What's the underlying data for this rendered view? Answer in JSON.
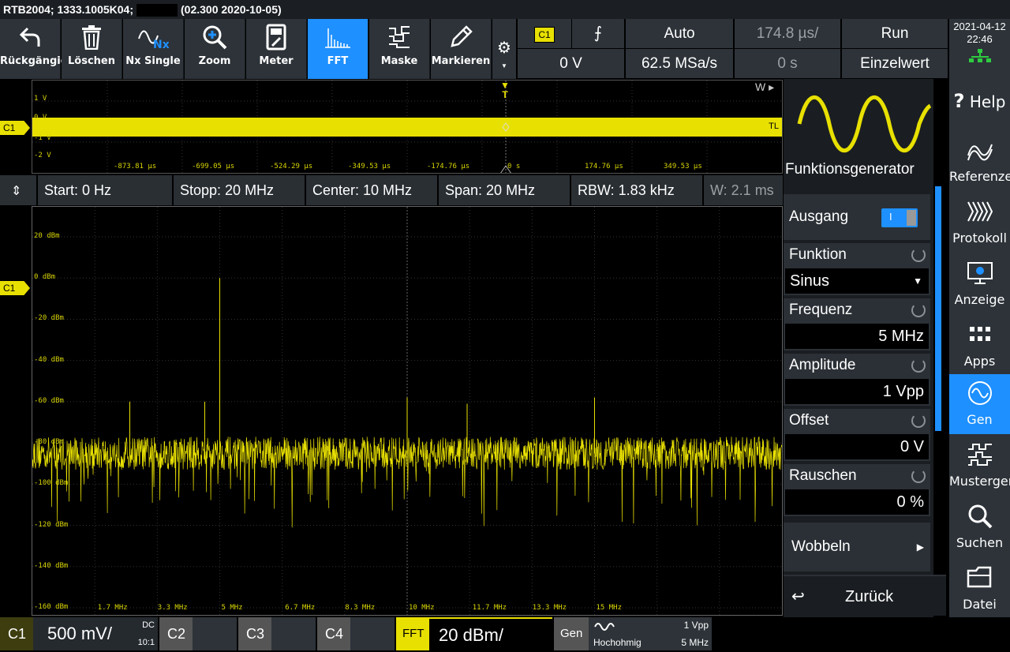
{
  "title_bar": {
    "text_a": "RTB2004; 1333.1005K04;",
    "text_b": "(02.300 2020-10-05)"
  },
  "toolbar": [
    {
      "label": "Rückgängig",
      "icon": "undo-icon"
    },
    {
      "label": "Löschen",
      "icon": "trash-icon"
    },
    {
      "label": "Nx Single",
      "icon": "nx-single-icon"
    },
    {
      "label": "Zoom",
      "icon": "zoom-icon"
    },
    {
      "label": "Meter",
      "icon": "meter-icon"
    },
    {
      "label": "FFT",
      "icon": "fft-icon"
    },
    {
      "label": "Maske",
      "icon": "mask-icon"
    },
    {
      "label": "Markieren",
      "icon": "pen-icon"
    }
  ],
  "trigger": {
    "channel": "C1",
    "level": "0 V",
    "mode": "Auto",
    "sample_rate": "62.5 MSa/s",
    "timebase": "174.8 µs/",
    "position": "0 s",
    "run_state": "Run",
    "acq_mode": "Einzelwert"
  },
  "clock": {
    "date": "2021-04-12",
    "time": "22:46"
  },
  "waveform": {
    "y_labels": [
      "1 V",
      "0 V",
      "-1 V",
      "-2 V"
    ],
    "x_labels": [
      "-873.81 µs",
      "-699.05 µs",
      "-524.29 µs",
      "-349.53 µs",
      "-174.76 µs",
      "0 s",
      "174.76 µs",
      "349.53 µs"
    ],
    "w_marker": "W",
    "tl_marker": "TL",
    "trigger_marker": "T",
    "ch_tag": "C1"
  },
  "spectrum_info": {
    "start": "Start: 0 Hz",
    "stop": "Stopp: 20 MHz",
    "center": "Center: 10 MHz",
    "span": "Span: 20 MHz",
    "rbw": "RBW: 1.83 kHz",
    "window": "W: 2.1 ms"
  },
  "chart_data": {
    "type": "line",
    "y_labels": [
      "20 dBm",
      "0 dBm",
      "-20 dBm",
      "-40 dBm",
      "-60 dBm",
      "-80 dBm",
      "-100 dBm",
      "-120 dBm",
      "-140 dBm",
      "-160 dBm"
    ],
    "x_labels": [
      "1.7 MHz",
      "3.3 MHz",
      "5 MHz",
      "6.7 MHz",
      "8.3 MHz",
      "10 MHz",
      "11.7 MHz",
      "13.3 MHz",
      "15 MHz"
    ],
    "xlim": [
      0,
      20
    ],
    "ylim": [
      -160,
      20
    ],
    "noise_floor_dbm": -85,
    "peaks": [
      {
        "freq_mhz": 5.0,
        "dbm": 0
      },
      {
        "freq_mhz": 10.0,
        "dbm": -58
      },
      {
        "freq_mhz": 15.0,
        "dbm": -58
      },
      {
        "freq_mhz": 4.6,
        "dbm": -60
      },
      {
        "freq_mhz": 2.6,
        "dbm": -60
      },
      {
        "freq_mhz": 11.6,
        "dbm": -61
      }
    ],
    "ch_tag": "C1",
    "grid": true,
    "color": "#e8e000"
  },
  "funcgen": {
    "title": "Funktionsgenerator",
    "output_label": "Ausgang",
    "output_toggle": "I",
    "function_label": "Funktion",
    "function_value": "Sinus",
    "freq_label": "Frequenz",
    "freq_value": "5 MHz",
    "amp_label": "Amplitude",
    "amp_value": "1 Vpp",
    "offset_label": "Offset",
    "offset_value": "0 V",
    "noise_label": "Rauschen",
    "noise_value": "0 %",
    "sweep_label": "Wobbeln",
    "back_label": "Zurück"
  },
  "sidebar": [
    {
      "label": "Help",
      "icon": "help-icon"
    },
    {
      "label": "Referenzen",
      "icon": "references-icon"
    },
    {
      "label": "Protokoll",
      "icon": "protocol-icon"
    },
    {
      "label": "Anzeige",
      "icon": "display-icon"
    },
    {
      "label": "Apps",
      "icon": "apps-icon"
    },
    {
      "label": "Gen",
      "icon": "generator-icon"
    },
    {
      "label": "Mustergen.",
      "icon": "pattern-gen-icon"
    },
    {
      "label": "Suchen",
      "icon": "search-icon"
    },
    {
      "label": "Datei",
      "icon": "folder-icon"
    }
  ],
  "bottom": {
    "c1": "C1",
    "c1_scale": "500 mV/",
    "c1_coupling": "DC",
    "c1_probe": "10:1",
    "c2": "C2",
    "c3": "C3",
    "c4": "C4",
    "fft": "FFT",
    "fft_scale": "20 dBm/",
    "gen": "Gen",
    "gen_load": "Hochohmig",
    "gen_amp": "1 Vpp",
    "gen_freq": "5 MHz"
  },
  "colors": {
    "accent": "#1e90ff",
    "trace": "#e8e000",
    "panel": "#2d3339"
  }
}
